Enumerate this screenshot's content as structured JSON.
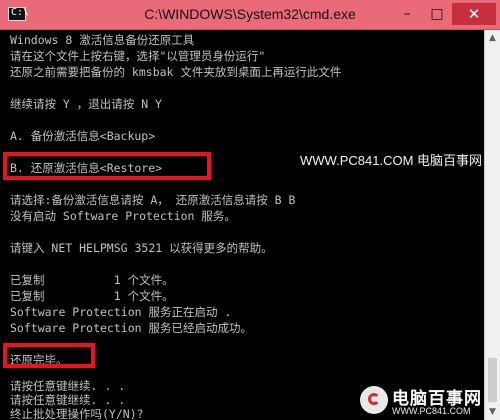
{
  "window": {
    "title": "C:\\WINDOWS\\System32\\cmd.exe",
    "icon": "cmd-icon",
    "icon_text": "C:\\",
    "controls": {
      "minimize": "–",
      "maximize": "□",
      "close": "✕"
    },
    "accent_color": "#ea6a79"
  },
  "console": {
    "lines": [
      "Windows 8 激活信息备份还原工具",
      "请在这个文件上按右键，选择\"以管理员身份运行\"",
      "还原之前需要把备份的 kmsbak 文件夹放到桌面上再运行此文件",
      "",
      "继续请按 Y ，退出请按 N Y",
      "",
      "A. 备份激活信息<Backup>",
      "",
      "B. 还原激活信息<Restore>",
      "",
      "请选择:备份激活信息请按 A， 还原激活信息请按 B B",
      "没有启动 Software Protection 服务。",
      "",
      "请键入 NET HELPMSG 3521 以获得更多的帮助。",
      "",
      "已复制          1 个文件。",
      "已复制          1 个文件。",
      "Software Protection 服务正在启动 .",
      "Software Protection 服务已经启动成功。",
      "",
      "还原完毕。",
      "",
      "请按任意键继续. . .",
      "请按任意键继续. . .",
      "终止批处理操作吗(Y/N)? "
    ],
    "text_color": "#c0c0c0",
    "background_color": "#000000"
  },
  "annotations": {
    "highlight_color": "#e8141d",
    "watermark": "WWW.PC841.COM 电脑百事网"
  },
  "logo": {
    "name": "电脑百事网",
    "url": "WWW.PC841.COM"
  }
}
